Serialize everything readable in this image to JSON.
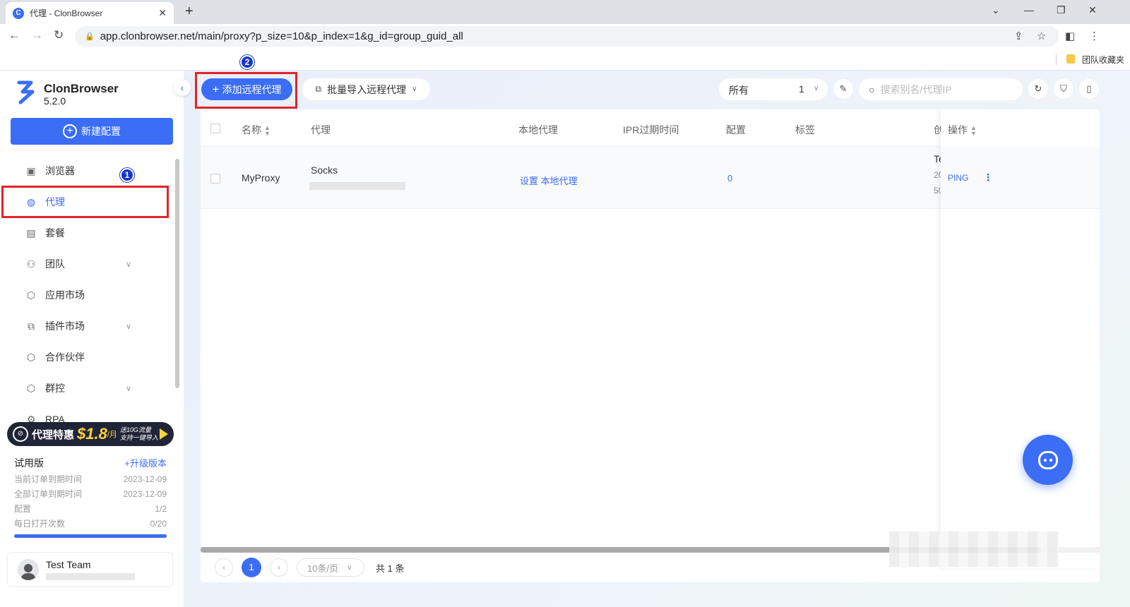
{
  "browser": {
    "tab_title": "代理 - ClonBrowser",
    "url": "app.clonbrowser.net/main/proxy?p_size=10&p_index=1&g_id=group_guid_all",
    "bookmark": "团队收藏夹"
  },
  "brand": {
    "name": "ClonBrowser",
    "version": "5.2.0"
  },
  "new_config_label": "新建配置",
  "menu": [
    {
      "label": "浏览器",
      "icon": "browser-icon"
    },
    {
      "label": "代理",
      "icon": "globe-icon"
    },
    {
      "label": "套餐",
      "icon": "wallet-icon"
    },
    {
      "label": "团队",
      "icon": "team-icon"
    },
    {
      "label": "应用市场",
      "icon": "cube-icon"
    },
    {
      "label": "插件市场",
      "icon": "puzzle-icon"
    },
    {
      "label": "合作伙伴",
      "icon": "cube-icon"
    },
    {
      "label": "群控",
      "icon": "cube-icon"
    },
    {
      "label": "RPA",
      "icon": "robot-icon"
    }
  ],
  "promo": {
    "text": "代理特惠",
    "price": "$1.8",
    "unit": "/月",
    "line1": "送10G流量",
    "line2": "支持一键导入"
  },
  "plan": {
    "name": "试用版",
    "upgrade": "+升级版本",
    "rows": [
      {
        "label": "当前订单到期时间",
        "value": "2023-12-09"
      },
      {
        "label": "全部订单到期时间",
        "value": "2023-12-09"
      },
      {
        "label": "配置",
        "value": "1/2"
      },
      {
        "label": "每日打开次数",
        "value": "0/20"
      }
    ]
  },
  "team": {
    "name": "Test Team"
  },
  "toolbar": {
    "add_proxy": "添加远程代理",
    "batch_import": "批量导入远程代理",
    "filter_label": "所有",
    "filter_count": "1",
    "search_placeholder": "搜索别名/代理IP"
  },
  "table": {
    "headers": {
      "name": "名称",
      "proxy": "代理",
      "local_proxy": "本地代理",
      "ipr_expire": "IPR过期时间",
      "config": "配置",
      "tags": "标签",
      "created": "创",
      "actions": "操作"
    },
    "rows": [
      {
        "name": "MyProxy",
        "proxy_type": "Socks",
        "local_proxy": "设置 本地代理",
        "config": "0",
        "created_1": "Te",
        "created_2": "20",
        "created_3": "50",
        "ping": "PING"
      }
    ]
  },
  "pagination": {
    "page": "1",
    "page_size": "10条/页",
    "total": "共 1 条"
  },
  "annotations": {
    "step1": "1",
    "step2": "2"
  },
  "colors": {
    "accent": "#3b6df5",
    "highlight": "#e0242b",
    "promo_bg": "#1f2437",
    "promo_price": "#ffd23f"
  }
}
